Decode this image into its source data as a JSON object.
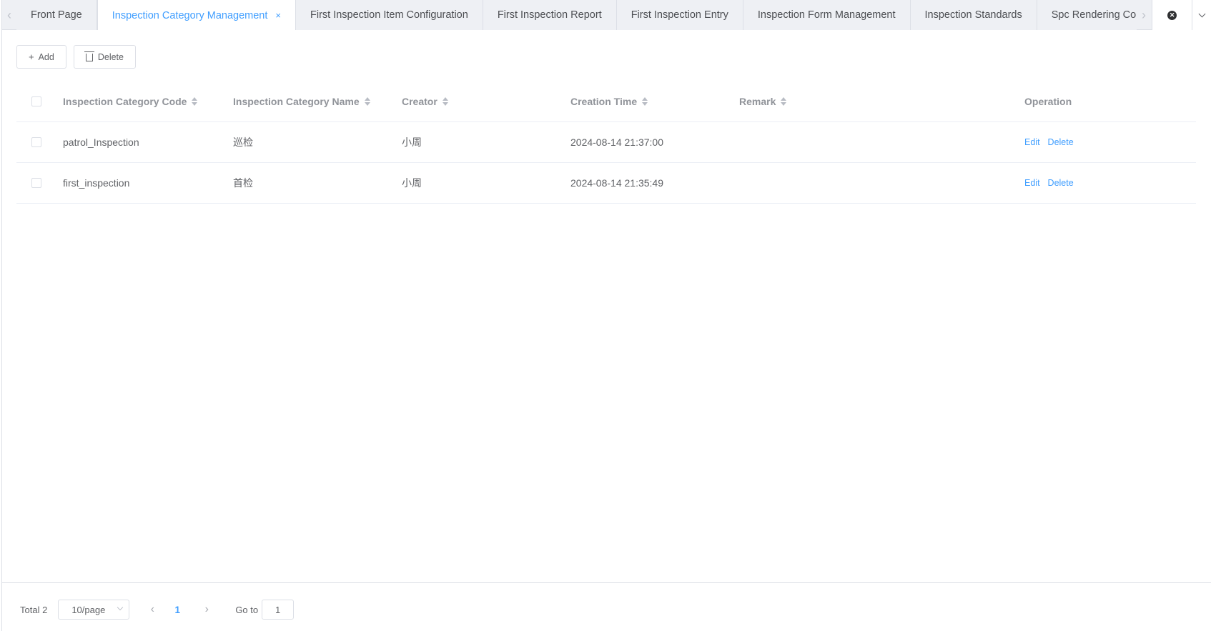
{
  "tabs": {
    "items": [
      {
        "label": "Front Page",
        "active": false
      },
      {
        "label": "Inspection Category Management",
        "active": true,
        "closable": true
      },
      {
        "label": "First Inspection Item Configuration",
        "active": false
      },
      {
        "label": "First Inspection Report",
        "active": false
      },
      {
        "label": "First Inspection Entry",
        "active": false
      },
      {
        "label": "Inspection Form Management",
        "active": false
      },
      {
        "label": "Inspection Standards",
        "active": false
      },
      {
        "label": "Spc Rendering Condit",
        "active": false
      }
    ],
    "close_glyph": "×",
    "prev_icon": "chevron-left-icon",
    "next_icon": "chevron-right-icon",
    "close_all_icon": "close-circle-icon",
    "more_icon": "chevron-down-icon"
  },
  "toolbar": {
    "add_label": "Add",
    "delete_label": "Delete"
  },
  "table": {
    "columns": [
      {
        "label": "Inspection Category Code",
        "sortable": true
      },
      {
        "label": "Inspection Category Name",
        "sortable": true
      },
      {
        "label": "Creator",
        "sortable": true
      },
      {
        "label": "Creation Time",
        "sortable": true
      },
      {
        "label": "Remark",
        "sortable": true
      },
      {
        "label": "Operation",
        "sortable": false
      }
    ],
    "rows": [
      {
        "code": "patrol_Inspection",
        "name": "巡检",
        "creator": "小周",
        "time": "2024-08-14 21:37:00",
        "remark": "",
        "edit": "Edit",
        "delete": "Delete"
      },
      {
        "code": "first_inspection",
        "name": "首检",
        "creator": "小周",
        "time": "2024-08-14 21:35:49",
        "remark": "",
        "edit": "Edit",
        "delete": "Delete"
      }
    ]
  },
  "pagination": {
    "total_label": "Total 2",
    "page_size": "10/page",
    "current_page": "1",
    "goto_label": "Go to",
    "goto_value": "1"
  },
  "colors": {
    "accent": "#409eff",
    "border": "#dcdfe6",
    "tabbar_bg": "#eef0f4"
  }
}
